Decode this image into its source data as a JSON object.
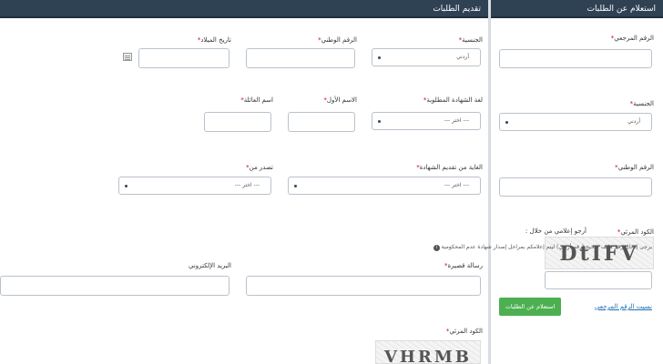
{
  "right_panel": {
    "title": "استعلام عن الطلبات",
    "reference_number_label": "الرقم المرجعي",
    "nationality_label": "الجنسية",
    "nationality_value": "أردني",
    "national_number_label": "الرقم الوطني",
    "captcha_label": "الكود المرئي",
    "captcha_text": "DtIFV",
    "forgot_reference_link": "نسيت الرقم المرجعي",
    "query_button": "استعلام عن الطلبات"
  },
  "left_panel": {
    "title": "تقديم الطلبات",
    "nationality_label": "الجنسية",
    "nationality_value": "أردني",
    "national_number_label": "الرقم الوطني",
    "birth_date_label": "تاريخ الميلاد",
    "certificate_language_label": "لغة الشهادة المطلوبة",
    "select_placeholder": "--- اختر ---",
    "first_name_label": "الاسم الأول",
    "family_name_label": "اسم العائلة",
    "certificate_purpose_label": "الغاية من تقديم الشهادة",
    "issued_from_label": "تصدر من",
    "notify_label": "أرجو إعلامي من خلال :",
    "notify_info": "يرجى إدخال رقم هاتف صحيح (رقم أردني) ليتم إعلامكم بمراحل إصدار شهادة عدم المحكومية",
    "sms_label": "رسالة قصيرة",
    "email_label": "البريد الإلكتروني",
    "captcha_label": "الكود المرئي",
    "captcha_text": "VHRMB"
  },
  "colors": {
    "header": "#2f4254",
    "button": "#4caf50",
    "required": "#d0021b"
  }
}
